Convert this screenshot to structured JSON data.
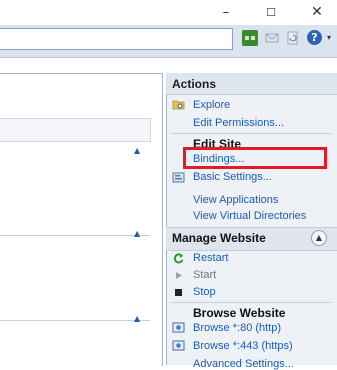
{
  "window": {
    "minimize_glyph": "–",
    "maximize_glyph": "☐",
    "close_glyph": "✕"
  },
  "toolbar": {
    "icons": [
      "network-icon",
      "mail-icon",
      "refresh-icon",
      "help-icon",
      "dropdown-arrow-icon"
    ]
  },
  "actions": {
    "title": "Actions",
    "explore": "Explore",
    "edit_permissions": "Edit Permissions...",
    "edit_site_header": "Edit Site",
    "bindings": "Bindings...",
    "basic_settings": "Basic Settings...",
    "view_applications": "View Applications",
    "view_virtual_directories": "View Virtual Directories",
    "manage_website": {
      "title": "Manage Website",
      "restart": "Restart",
      "start": "Start",
      "stop": "Stop"
    },
    "browse_website": {
      "title": "Browse Website",
      "browse_80": "Browse *:80 (http)",
      "browse_443": "Browse *:443 (https)",
      "advanced_settings": "Advanced Settings..."
    }
  },
  "colors": {
    "link": "#1a5cb5",
    "highlight_border": "#e21b24",
    "toolbar_band": "#dbe3ee"
  }
}
